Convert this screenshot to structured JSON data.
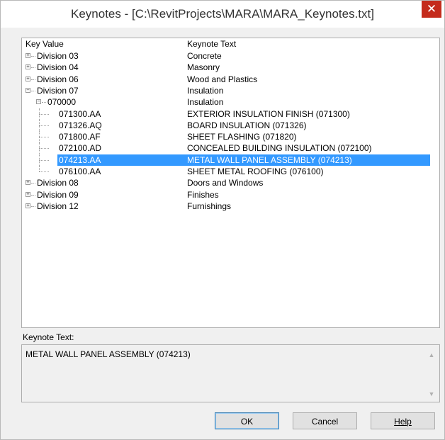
{
  "window": {
    "title": "Keynotes - [C:\\RevitProjects\\MARA\\MARA_Keynotes.txt]",
    "close_glyph": "✕"
  },
  "tree": {
    "columns": {
      "key": "Key Value",
      "text": "Keynote Text"
    },
    "rows": [
      {
        "key": "Division 03",
        "text": "Concrete",
        "expander": "+",
        "level": 0
      },
      {
        "key": "Division 04",
        "text": "Masonry",
        "expander": "+",
        "level": 0
      },
      {
        "key": "Division 06",
        "text": "Wood and Plastics",
        "expander": "+",
        "level": 0
      },
      {
        "key": "Division 07",
        "text": "Insulation",
        "expander": "−",
        "level": 0
      },
      {
        "key": "070000",
        "text": "Insulation",
        "expander": "−",
        "level": 1
      },
      {
        "key": "071300.AA",
        "text": "EXTERIOR INSULATION FINISH (071300)",
        "level": 2
      },
      {
        "key": "071326.AQ",
        "text": "BOARD INSULATION (071326)",
        "level": 2
      },
      {
        "key": "071800.AF",
        "text": "SHEET FLASHING (071820)",
        "level": 2
      },
      {
        "key": "072100.AD",
        "text": "CONCEALED BUILDING INSULATION (072100)",
        "level": 2
      },
      {
        "key": "074213.AA",
        "text": "METAL WALL PANEL ASSEMBLY (074213)",
        "level": 2,
        "selected": true
      },
      {
        "key": "076100.AA",
        "text": "SHEET METAL ROOFING (076100)",
        "level": 2
      },
      {
        "key": "Division 08",
        "text": "Doors and Windows",
        "expander": "+",
        "level": 0
      },
      {
        "key": "Division 09",
        "text": "Finishes",
        "expander": "+",
        "level": 0
      },
      {
        "key": "Division 12",
        "text": "Furnishings",
        "expander": "+",
        "level": 0
      }
    ]
  },
  "keynote_text": {
    "label": "Keynote Text:",
    "value": "METAL WALL PANEL ASSEMBLY (074213)"
  },
  "buttons": {
    "ok": "OK",
    "cancel": "Cancel",
    "help": "Help"
  },
  "colors": {
    "selection": "#3399ff",
    "close": "#c42b1c"
  }
}
